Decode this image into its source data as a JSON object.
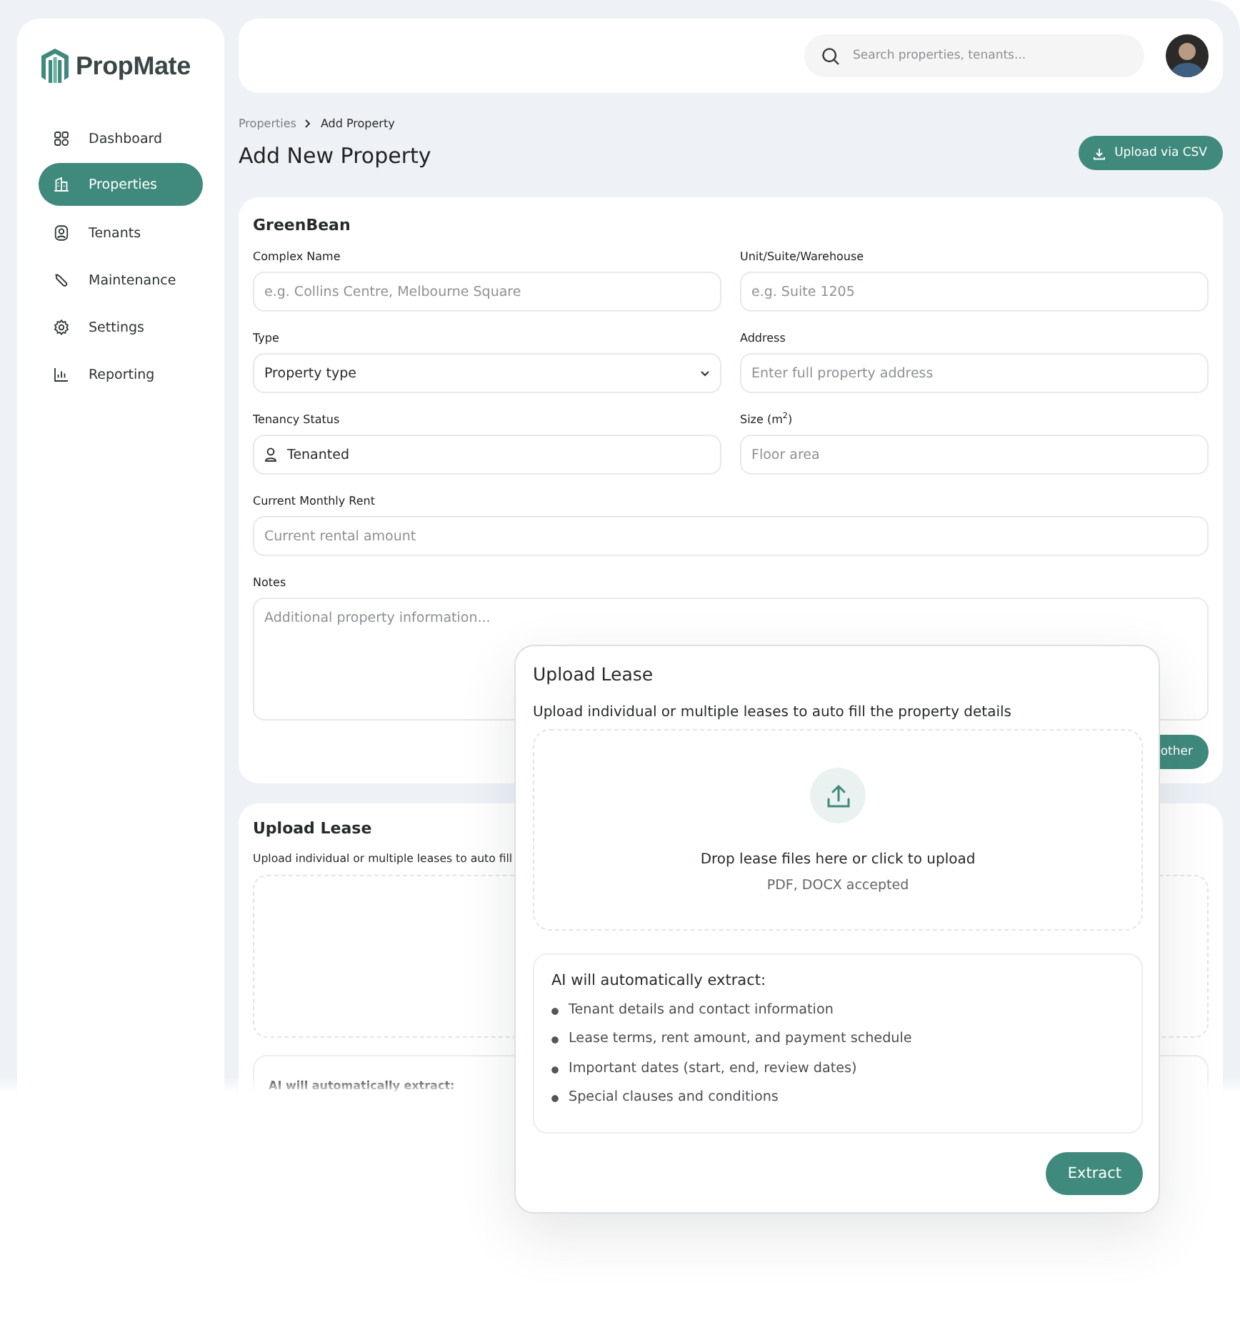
{
  "sidebar": {
    "logo": "PropMate",
    "items": [
      {
        "label": "Dashboard",
        "selected": false
      },
      {
        "label": "Properties",
        "selected": true
      },
      {
        "label": "Tenants",
        "selected": false
      },
      {
        "label": "Maintenance",
        "selected": false
      },
      {
        "label": "Settings",
        "selected": false
      },
      {
        "label": "Reporting",
        "selected": false
      }
    ]
  },
  "topbar": {
    "search": {
      "placeholder": "Search properties, tenants..."
    }
  },
  "breadcrumb": [
    "Properties",
    "Add Property"
  ],
  "title": "Add New Property",
  "csv_button": "Upload via CSV",
  "form": {
    "heading": "GreenBean",
    "rows": [
      [
        {
          "label": "Complex Name",
          "kind": "text",
          "placeholder": "e.g. Collins Centre, Melbourne Square"
        },
        {
          "label": "Unit/Suite/Warehouse",
          "kind": "text",
          "placeholder": "e.g. Suite 1205"
        }
      ],
      [
        {
          "label": "Type",
          "kind": "select",
          "value": "Property type"
        },
        {
          "label": "Address",
          "kind": "text",
          "placeholder": "Enter full property address"
        }
      ],
      [
        {
          "label": "Tenancy Status",
          "kind": "status",
          "value": "Tenanted"
        },
        {
          "label": "Size (m$^{2}$)",
          "kind": "text",
          "placeholder": "Floor area"
        }
      ],
      [
        {
          "label": "Current Monthly Rent",
          "kind": "text",
          "placeholder": "Current rental amount"
        }
      ],
      [
        {
          "label": "Notes",
          "kind": "textarea",
          "placeholder": "Additional property information..."
        }
      ]
    ],
    "action": "other"
  },
  "upload_card": {
    "title": "Upload Lease",
    "subtitle": "Upload individual or multiple leases to auto fill",
    "extract_heading": "AI will automatically extract:"
  },
  "modal": {
    "title": "Upload Lease",
    "subtitle": "Upload individual or multiple leases to auto fill the property details",
    "drop_text": "Drop lease files here or click to upload",
    "drop_hint": "PDF, DOCX accepted",
    "extract_heading": "AI will automatically extract:",
    "extract_items": [
      "Tenant details and contact information",
      "Lease terms, rent amount, and payment schedule",
      "Important dates (start, end, review dates)",
      "Special clauses and conditions"
    ],
    "button": "Extract"
  }
}
